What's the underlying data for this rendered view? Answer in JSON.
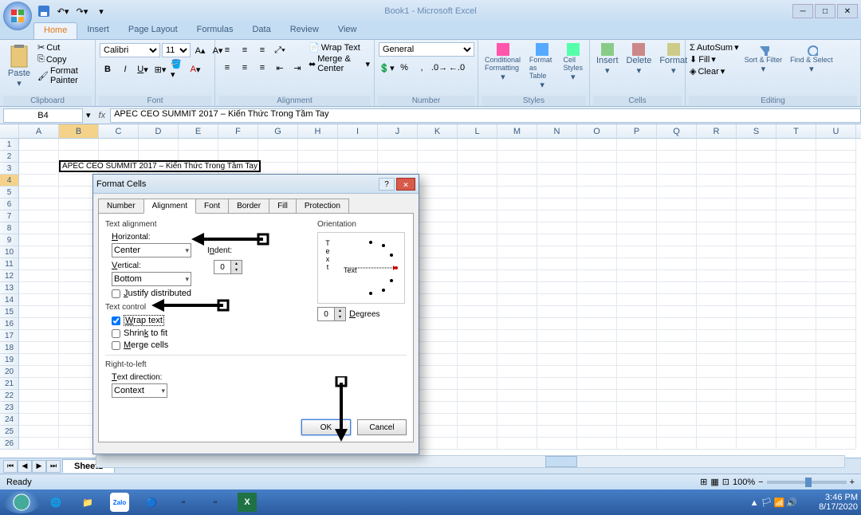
{
  "window": {
    "title": "Book1 - Microsoft Excel"
  },
  "tabs": [
    "Home",
    "Insert",
    "Page Layout",
    "Formulas",
    "Data",
    "Review",
    "View"
  ],
  "active_tab": "Home",
  "ribbon_groups": {
    "clipboard": {
      "title": "Clipboard",
      "paste": "Paste",
      "cut": "Cut",
      "copy": "Copy",
      "fp": "Format Painter"
    },
    "font": {
      "title": "Font",
      "name": "Calibri",
      "size": "11"
    },
    "alignment": {
      "title": "Alignment",
      "wrap": "Wrap Text",
      "merge": "Merge & Center"
    },
    "number": {
      "title": "Number",
      "format": "General"
    },
    "styles": {
      "title": "Styles",
      "cf": "Conditional Formatting",
      "ft": "Format as Table",
      "cs": "Cell Styles"
    },
    "cells": {
      "title": "Cells",
      "ins": "Insert",
      "del": "Delete",
      "fmt": "Format"
    },
    "editing": {
      "title": "Editing",
      "sum": "AutoSum",
      "fill": "Fill",
      "clear": "Clear",
      "sort": "Sort & Filter",
      "find": "Find & Select"
    }
  },
  "name_box": "B4",
  "formula": "APEC CEO SUMMIT 2017 – Kiến Thức Trong Tầm Tay",
  "columns": [
    "A",
    "B",
    "C",
    "D",
    "E",
    "F",
    "G",
    "H",
    "I",
    "J",
    "K",
    "L",
    "M",
    "N",
    "O",
    "P",
    "Q",
    "R",
    "S",
    "T",
    "U"
  ],
  "rows_visible": 26,
  "selected_cell_text": "APEC CEO SUMMIT 2017 – Kiến Thức Trong Tầm Tay",
  "sheet_tab": "Sheet1",
  "status": "Ready",
  "zoom": "100%",
  "dialog": {
    "title": "Format Cells",
    "tabs": [
      "Number",
      "Alignment",
      "Font",
      "Border",
      "Fill",
      "Protection"
    ],
    "active_tab": "Alignment",
    "text_alignment_label": "Text alignment",
    "horizontal_label": "Horizontal:",
    "horizontal_value": "Center",
    "indent_label": "Indent:",
    "indent_value": "0",
    "vertical_label": "Vertical:",
    "vertical_value": "Bottom",
    "justify_label": "Justify distributed",
    "text_control_label": "Text control",
    "wrap_label": "Wrap text",
    "shrink_label": "Shrink to fit",
    "merge_label": "Merge cells",
    "rtl_label": "Right-to-left",
    "textdir_label": "Text direction:",
    "textdir_value": "Context",
    "orientation_label": "Orientation",
    "orientation_text": "Text",
    "degrees_label": "Degrees",
    "degrees_value": "0",
    "ok": "OK",
    "cancel": "Cancel"
  },
  "taskbar": {
    "time": "3:46 PM",
    "date": "8/17/2020"
  }
}
